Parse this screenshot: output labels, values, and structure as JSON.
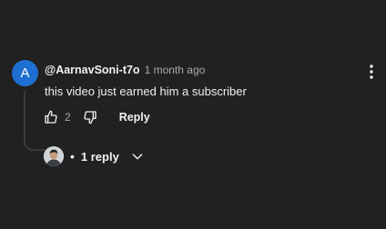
{
  "comment": {
    "avatar_letter": "A",
    "avatar_color": "#1e6fd2",
    "author": "@AarnavSoni-t7o",
    "time": "1 month ago",
    "text": "this video just earned him a subscriber",
    "like_count": "2",
    "reply_label": "Reply",
    "icons": {
      "like": "thumbs-up-icon",
      "dislike": "thumbs-down-icon",
      "menu": "more-vert-icon",
      "expand": "chevron-down-icon"
    }
  },
  "replies": {
    "dot": "•",
    "count_label": "1 reply"
  },
  "colors": {
    "background": "#212121",
    "text_primary": "#f1f1f1",
    "text_secondary": "#aaaaaa"
  }
}
